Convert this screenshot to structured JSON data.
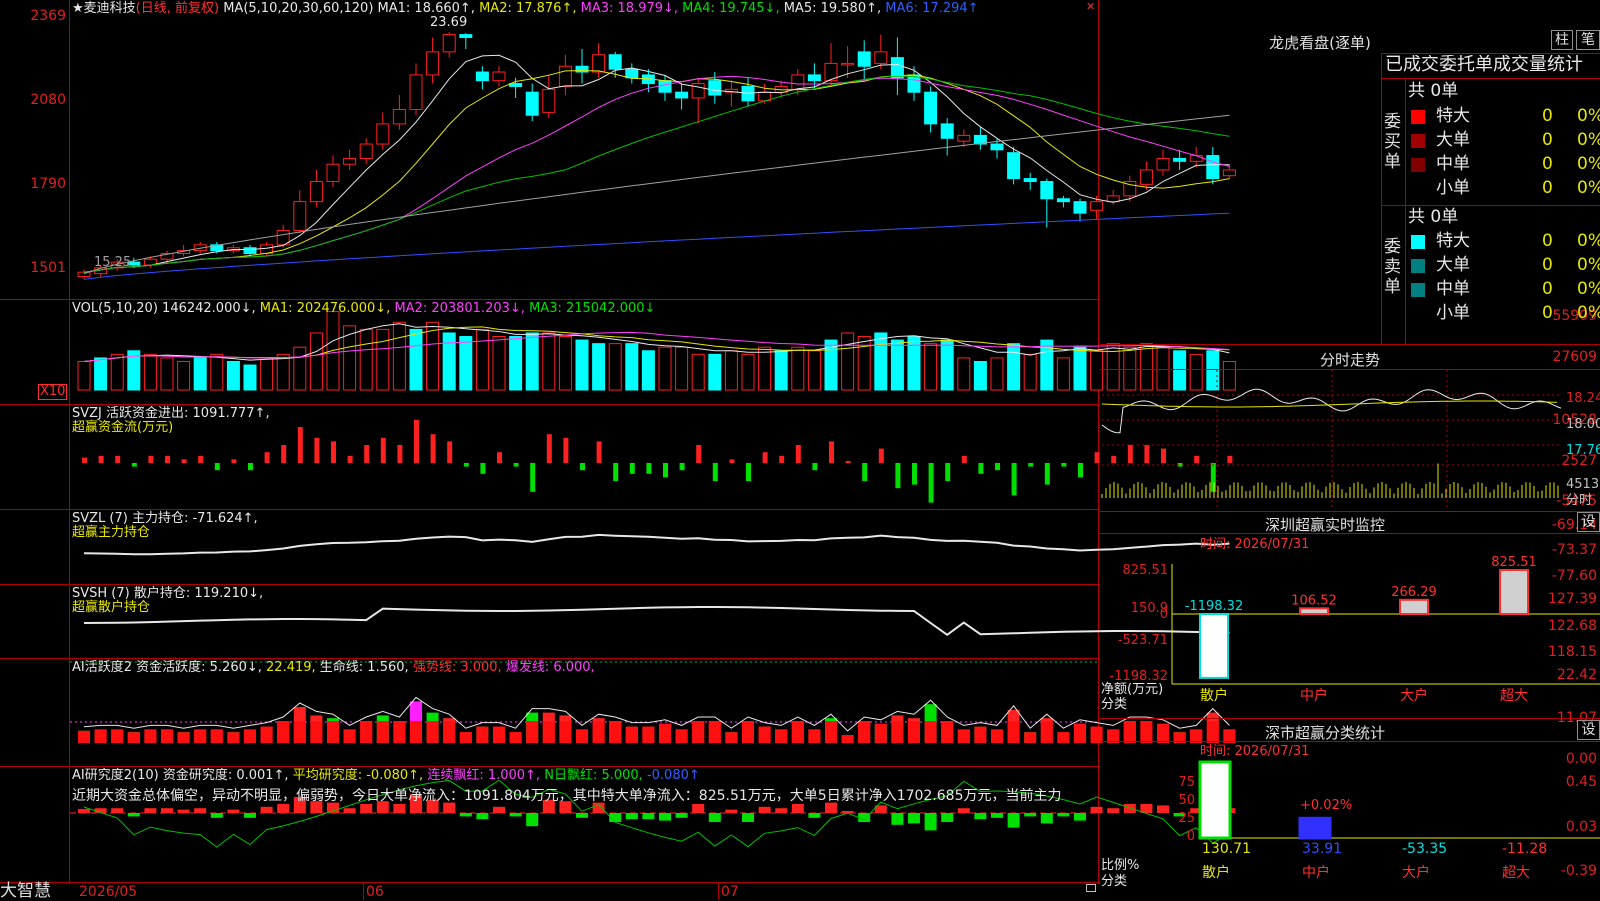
{
  "main_chart": {
    "stock_name": "★麦迪科技",
    "mode": "(日线, 前复权)",
    "ma_params": "MA(5,10,20,30,60,120)",
    "ma1": "MA1: 18.660↑,",
    "ma2": "MA2: 17.876↑,",
    "ma3": "MA3: 18.979↓,",
    "ma4": "MA4: 19.745↓,",
    "ma5": "MA5: 19.580↑,",
    "ma6": "MA6: 17.294↑",
    "high_label": "23.69",
    "low_label": "15.25",
    "y_ticks": [
      "2369",
      "2080",
      "1790",
      "1501"
    ]
  },
  "vol_panel": {
    "label": "VOL(5,10,20)",
    "value": "146242.000↓,",
    "ma1": "MA1: 202476.000↓,",
    "ma2": "MA2: 203801.203↓,",
    "ma3": "MA3: 215042.000↓",
    "y_ticks": [
      "55909",
      "27609"
    ],
    "unit": "X10"
  },
  "svzj_panel": {
    "label": "SVZJ  活跃资金进出: 1091.777↑,",
    "sub": "超赢资金流(万元)",
    "y_ticks": [
      "10528",
      "2527",
      "-5475"
    ]
  },
  "svzl_panel": {
    "label": "SVZL (7) 主力持仓: -71.624↑,",
    "sub": "超赢主力持仓",
    "y_ticks": [
      "-69.14",
      "-73.37",
      "-77.60"
    ]
  },
  "svsh_panel": {
    "label": "SVSH (7) 散户持仓: 119.210↓,",
    "sub": "超赢散户持仓",
    "y_ticks": [
      "127.39",
      "122.68",
      "118.15"
    ]
  },
  "ai_active_panel": {
    "label": "AI活跃度2 资金活跃度: 5.260↓,",
    "v2": "22.419,",
    "v3": "生命线: 1.560,",
    "v4": "强势线: 3.000,",
    "v5": "爆发线: 6.000,",
    "y_ticks": [
      "22.42",
      "11.07",
      "0.00"
    ]
  },
  "ai_research_panel": {
    "label": "AI研究度2(10) 资金研究度: 0.001↑,",
    "v2": "平均研究度: -0.080↑,",
    "v3": "连续飘红: 1.000↑,",
    "v4": "N日飘红: 5.000,",
    "v5": "-0.080↑",
    "comment": "近期大资金总体偏空，异动不明显，偏弱势，今日大单净流入：1091.804万元，其中特大单净流入：825.51万元，大单5日累计净入1702.685万元，当前主力",
    "y_ticks": [
      "0.45",
      "0.03",
      "-0.39"
    ]
  },
  "bottom_bar": {
    "brand": "大智慧",
    "dates": [
      "2026/05",
      "06",
      "07"
    ]
  },
  "right_panel": {
    "dragon_title": "龙虎看盘(逐单)",
    "btn_bar": "柱",
    "btn_pen": "笔",
    "stats_title": "已成交委托单成交量统计",
    "buy_label": "委买单",
    "sell_label": "委卖单",
    "buy_total": "共 0单",
    "sell_total": "共 0单",
    "buy_rows": [
      {
        "name": "特大",
        "count": "0",
        "pct": "0%",
        "color": "#ff0000"
      },
      {
        "name": "大单",
        "count": "0",
        "pct": "0%",
        "color": "#a00000"
      },
      {
        "name": "中单",
        "count": "0",
        "pct": "0%",
        "color": "#800000"
      },
      {
        "name": "小单",
        "count": "0",
        "pct": "0%",
        "color": ""
      }
    ],
    "sell_rows": [
      {
        "name": "特大",
        "count": "0",
        "pct": "0%",
        "color": "#00ffff"
      },
      {
        "name": "大单",
        "count": "0",
        "pct": "0%",
        "color": "#008080"
      },
      {
        "name": "中单",
        "count": "0",
        "pct": "0%",
        "color": "#008080"
      },
      {
        "name": "小单",
        "count": "0",
        "pct": "0%",
        "color": ""
      }
    ],
    "intraday_title": "分时走势",
    "intraday_prices": [
      "18.24",
      "18.00",
      "17.76"
    ],
    "intraday_vol": "4513",
    "intraday_unit": "分时",
    "monitor_title": "深圳超赢实时监控",
    "settings": "设",
    "monitor_time": "时间: 2026/07/31",
    "monitor_y": [
      "825.51",
      "150.9",
      "0",
      "-523.71",
      "-1198.32"
    ],
    "monitor_values": [
      "-1198.32",
      "106.52",
      "266.29",
      "825.51"
    ],
    "monitor_axis": [
      "净额(万元)",
      "分类"
    ],
    "categories": [
      "散户",
      "中户",
      "大户",
      "超大"
    ],
    "class_title": "深市超赢分类统计",
    "class_time": "时间: 2026/07/31",
    "class_y": [
      "75",
      "50",
      "25",
      "0"
    ],
    "class_pct": "+0.02%",
    "class_values": [
      "130.71",
      "33.91",
      "-53.35",
      "-11.28"
    ],
    "class_axis": [
      "比例%",
      "分类"
    ]
  },
  "chart_data": {
    "type": "candlestick",
    "title": "麦迪科技 日线 前复权",
    "ylim": [
      15.01,
      23.69
    ],
    "x_labels": [
      "2026/05",
      "06",
      "07"
    ],
    "candles": [
      [
        15.2,
        15.35,
        15.1,
        15.45
      ],
      [
        15.3,
        15.5,
        15.2,
        15.6
      ],
      [
        15.5,
        15.7,
        15.4,
        15.8
      ],
      [
        15.7,
        15.6,
        15.5,
        15.85
      ],
      [
        15.6,
        15.8,
        15.5,
        15.9
      ],
      [
        15.8,
        16.0,
        15.7,
        16.1
      ],
      [
        16.0,
        16.1,
        15.9,
        16.3
      ],
      [
        16.1,
        16.3,
        16.0,
        16.4
      ],
      [
        16.3,
        16.1,
        16.0,
        16.4
      ],
      [
        16.1,
        16.2,
        16.0,
        16.3
      ],
      [
        16.2,
        16.0,
        15.9,
        16.3
      ],
      [
        16.0,
        16.3,
        15.9,
        16.4
      ],
      [
        16.3,
        16.8,
        16.2,
        17.0
      ],
      [
        16.8,
        17.8,
        16.7,
        18.2
      ],
      [
        17.8,
        18.5,
        17.6,
        18.9
      ],
      [
        18.5,
        19.1,
        18.3,
        19.4
      ],
      [
        19.1,
        19.3,
        18.9,
        19.6
      ],
      [
        19.3,
        19.8,
        19.1,
        20.0
      ],
      [
        19.8,
        20.5,
        19.6,
        20.9
      ],
      [
        20.5,
        21.0,
        20.3,
        21.5
      ],
      [
        21.0,
        22.2,
        20.8,
        22.6
      ],
      [
        22.2,
        23.0,
        21.9,
        23.5
      ],
      [
        23.0,
        23.6,
        22.8,
        23.69
      ],
      [
        23.6,
        23.5,
        23.1,
        23.65
      ],
      [
        22.3,
        22.0,
        21.7,
        22.5
      ],
      [
        22.0,
        22.3,
        21.8,
        22.5
      ],
      [
        21.9,
        21.8,
        21.4,
        22.1
      ],
      [
        21.6,
        20.8,
        20.6,
        21.9
      ],
      [
        20.9,
        21.7,
        20.7,
        22.2
      ],
      [
        21.8,
        22.5,
        21.5,
        22.9
      ],
      [
        22.5,
        22.3,
        21.9,
        23.1
      ],
      [
        22.3,
        22.9,
        22.1,
        23.3
      ],
      [
        22.9,
        22.4,
        22.1,
        23.0
      ],
      [
        22.4,
        22.1,
        21.9,
        22.6
      ],
      [
        22.2,
        21.9,
        21.6,
        22.4
      ],
      [
        22.0,
        21.6,
        21.3,
        22.2
      ],
      [
        21.6,
        21.4,
        21.0,
        21.9
      ],
      [
        21.4,
        21.9,
        20.5,
        22.1
      ],
      [
        22.0,
        21.5,
        21.2,
        22.3
      ],
      [
        21.6,
        21.7,
        21.1,
        22.0
      ],
      [
        21.8,
        21.3,
        21.1,
        22.1
      ],
      [
        21.3,
        21.6,
        21.2,
        21.9
      ],
      [
        21.6,
        21.8,
        21.4,
        22.0
      ],
      [
        21.7,
        22.2,
        21.5,
        22.4
      ],
      [
        22.2,
        22.0,
        21.7,
        22.6
      ],
      [
        22.0,
        22.6,
        21.8,
        23.3
      ],
      [
        22.6,
        22.6,
        22.1,
        23.2
      ],
      [
        23.0,
        22.5,
        22.0,
        23.4
      ],
      [
        22.6,
        23.0,
        22.4,
        23.6
      ],
      [
        22.8,
        22.1,
        21.5,
        23.5
      ],
      [
        22.2,
        21.6,
        21.3,
        22.5
      ],
      [
        21.6,
        20.5,
        20.2,
        21.8
      ],
      [
        20.5,
        20.0,
        19.4,
        20.7
      ],
      [
        19.9,
        20.1,
        19.7,
        20.3
      ],
      [
        20.1,
        19.8,
        19.6,
        20.4
      ],
      [
        19.8,
        19.6,
        19.3,
        20.0
      ],
      [
        19.5,
        18.6,
        18.4,
        19.7
      ],
      [
        18.6,
        18.5,
        18.2,
        18.8
      ],
      [
        18.5,
        17.9,
        16.9,
        18.6
      ],
      [
        17.9,
        17.8,
        17.6,
        18.0
      ],
      [
        17.8,
        17.4,
        17.1,
        17.9
      ],
      [
        17.5,
        17.8,
        17.2,
        18.0
      ],
      [
        17.8,
        18.0,
        17.7,
        18.2
      ],
      [
        18.0,
        18.5,
        17.8,
        18.7
      ],
      [
        18.4,
        18.9,
        18.2,
        19.2
      ],
      [
        18.9,
        19.3,
        18.7,
        19.6
      ],
      [
        19.3,
        19.2,
        18.9,
        19.6
      ],
      [
        19.2,
        19.4,
        19.0,
        19.7
      ],
      [
        19.4,
        18.6,
        18.4,
        19.7
      ],
      [
        18.7,
        18.9,
        18.6,
        19.1
      ]
    ],
    "volumes": [
      [
        8,
        1
      ],
      [
        9,
        0
      ],
      [
        10,
        1
      ],
      [
        11,
        0
      ],
      [
        10,
        1
      ],
      [
        9,
        1
      ],
      [
        8,
        1
      ],
      [
        9,
        0
      ],
      [
        10,
        1
      ],
      [
        8,
        0
      ],
      [
        7,
        0
      ],
      [
        9,
        1
      ],
      [
        10,
        1
      ],
      [
        12,
        1
      ],
      [
        16,
        1
      ],
      [
        22,
        1
      ],
      [
        18,
        1
      ],
      [
        17,
        1
      ],
      [
        17,
        1
      ],
      [
        19,
        1
      ],
      [
        17,
        0
      ],
      [
        19,
        1
      ],
      [
        16,
        0
      ],
      [
        15,
        0
      ],
      [
        17,
        1
      ],
      [
        15,
        1
      ],
      [
        15,
        0
      ],
      [
        16,
        0
      ],
      [
        16,
        1
      ],
      [
        15,
        1
      ],
      [
        14,
        0
      ],
      [
        13,
        0
      ],
      [
        13,
        1
      ],
      [
        13,
        0
      ],
      [
        11,
        0
      ],
      [
        12,
        1
      ],
      [
        12,
        1
      ],
      [
        10,
        1
      ],
      [
        10,
        0
      ],
      [
        11,
        1
      ],
      [
        10,
        1
      ],
      [
        12,
        1
      ],
      [
        11,
        0
      ],
      [
        12,
        1
      ],
      [
        11,
        1
      ],
      [
        14,
        0
      ],
      [
        16,
        1
      ],
      [
        15,
        1
      ],
      [
        16,
        0
      ],
      [
        14,
        0
      ],
      [
        15,
        0
      ],
      [
        13,
        1
      ],
      [
        14,
        0
      ],
      [
        9,
        1
      ],
      [
        8,
        0
      ],
      [
        9,
        1
      ],
      [
        13,
        0
      ],
      [
        10,
        1
      ],
      [
        14,
        0
      ],
      [
        9,
        1
      ],
      [
        12,
        0
      ],
      [
        11,
        1
      ],
      [
        13,
        1
      ],
      [
        12,
        1
      ],
      [
        13,
        1
      ],
      [
        12,
        1
      ],
      [
        11,
        0
      ],
      [
        10,
        1
      ],
      [
        11,
        0
      ],
      [
        8,
        1
      ]
    ]
  }
}
